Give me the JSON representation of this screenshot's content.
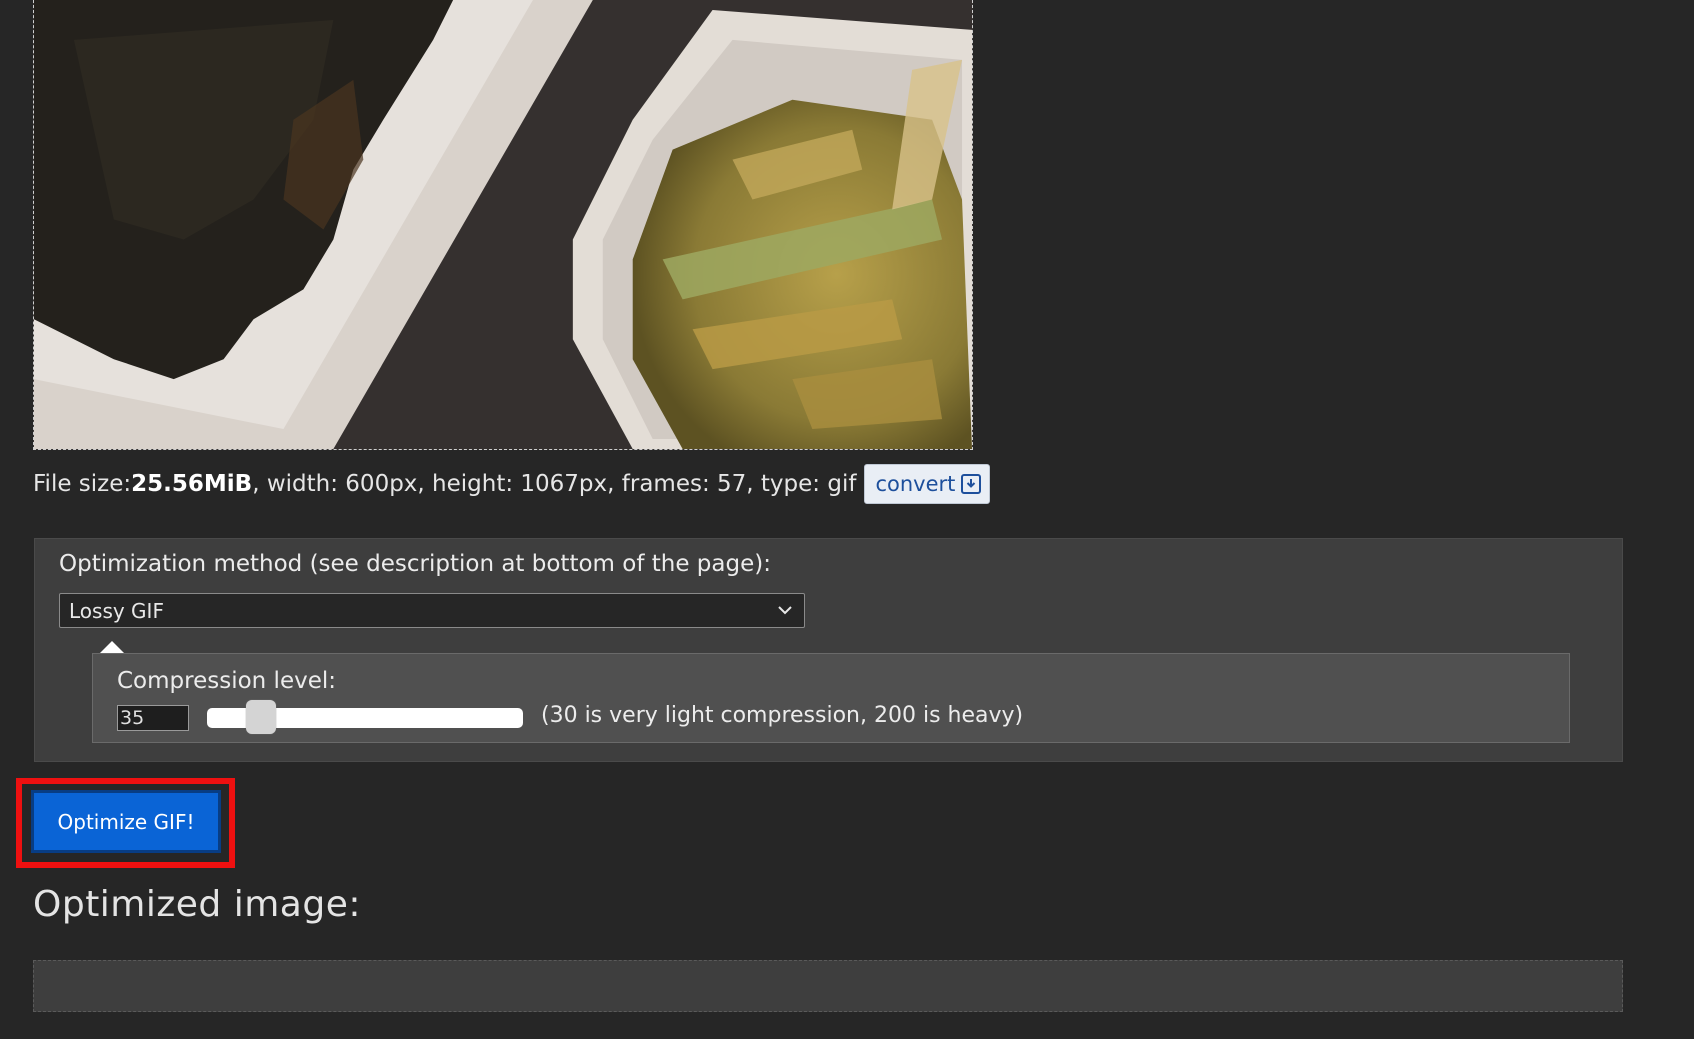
{
  "preview": {
    "image_alt": "food-photo-preview"
  },
  "file_info": {
    "prefix": "File size: ",
    "size": "25.56MiB",
    "details": ", width: 600px, height: 1067px, frames: 57, type: gif",
    "convert_label": "convert",
    "convert_icon": "download-icon"
  },
  "options": {
    "method_label": "Optimization method (see description at bottom of the page):",
    "method_selected": "Lossy GIF",
    "compression": {
      "label": "Compression level:",
      "value": "35",
      "min": 30,
      "max": 200,
      "hint": "(30 is very light compression, 200 is heavy)"
    }
  },
  "actions": {
    "optimize_label": "Optimize GIF!"
  },
  "result": {
    "title": "Optimized image:"
  },
  "colors": {
    "background": "#262626",
    "panel": "#3e3e3e",
    "primary_button": "#0a64d6",
    "highlight": "#ee1010"
  }
}
